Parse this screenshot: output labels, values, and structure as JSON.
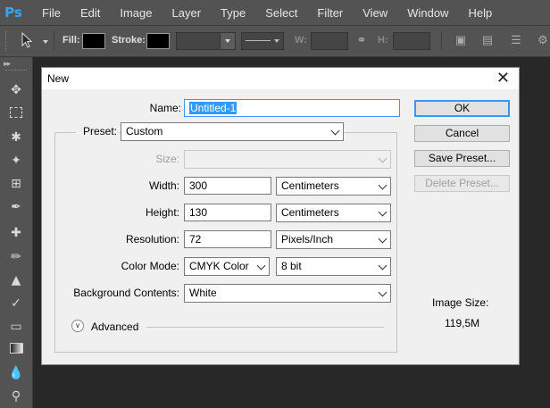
{
  "menubar": {
    "logo": "Ps",
    "items": [
      "File",
      "Edit",
      "Image",
      "Layer",
      "Type",
      "Select",
      "Filter",
      "View",
      "Window",
      "Help"
    ]
  },
  "options_bar": {
    "tool_icon": "pointer-icon",
    "fill_label": "Fill:",
    "stroke_label": "Stroke:",
    "w_label": "W:",
    "h_label": "H:"
  },
  "toolbox": {
    "tools": [
      "move-icon",
      "marquee-icon",
      "lasso-icon",
      "magic-wand-icon",
      "crop-icon",
      "eyedropper-icon",
      "healing-brush-icon",
      "brush-icon",
      "clone-stamp-icon",
      "history-brush-icon",
      "eraser-icon",
      "gradient-icon",
      "blur-icon",
      "dodge-icon"
    ]
  },
  "dialog": {
    "title": "New",
    "name_label": "Name:",
    "name_value": "Untitled-1",
    "preset_label": "Preset:",
    "preset_value": "Custom",
    "size_label": "Size:",
    "width_label": "Width:",
    "width_value": "300",
    "width_unit": "Centimeters",
    "height_label": "Height:",
    "height_value": "130",
    "height_unit": "Centimeters",
    "resolution_label": "Resolution:",
    "resolution_value": "72",
    "resolution_unit": "Pixels/Inch",
    "color_mode_label": "Color Mode:",
    "color_mode_value": "CMYK Color",
    "bit_depth_value": "8 bit",
    "background_label": "Background Contents:",
    "background_value": "White",
    "advanced_label": "Advanced",
    "image_size_label": "Image Size:",
    "image_size_value": "119,5M",
    "buttons": {
      "ok": "OK",
      "cancel": "Cancel",
      "save_preset": "Save Preset...",
      "delete_preset": "Delete Preset..."
    }
  },
  "colors": {
    "chrome": "#535353",
    "workspace": "#282828",
    "dialog_bg": "#f0f0f0",
    "accent": "#3399ff"
  }
}
